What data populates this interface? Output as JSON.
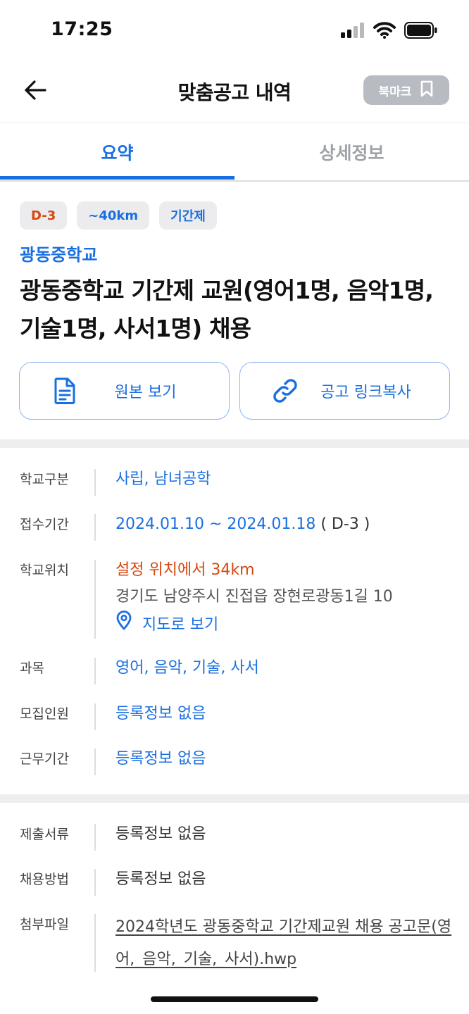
{
  "status_bar": {
    "time": "17:25"
  },
  "nav": {
    "title": "맞춤공고 내역",
    "bookmark_label": "북마크"
  },
  "tabs": [
    {
      "label": "요약",
      "active": true
    },
    {
      "label": "상세정보",
      "active": false
    }
  ],
  "badges": {
    "dday": "D-3",
    "distance": "~40km",
    "type": "기간제"
  },
  "school_name": "광동중학교",
  "posting_title": "광동중학교 기간제 교원(영어1명, 음악1명, 기술1명, 사서1명) 채용",
  "actions": {
    "view_original": "원본 보기",
    "copy_link": "공고 링크복사"
  },
  "info": {
    "school_type": {
      "label": "학교구분",
      "value": "사립, 남녀공학"
    },
    "application_period": {
      "label": "접수기간",
      "value": "2024.01.10 ~ 2024.01.18",
      "dday": "( D-3 )"
    },
    "location": {
      "label": "학교위치",
      "distance": "설정 위치에서 34km",
      "address": "경기도 남양주시 진접읍 장현로광동1길 10",
      "map_link": "지도로 보기"
    },
    "subjects": {
      "label": "과목",
      "value": "영어, 음악, 기술, 사서"
    },
    "headcount": {
      "label": "모집인원",
      "value": "등록정보 없음"
    },
    "work_period": {
      "label": "근무기간",
      "value": "등록정보 없음"
    }
  },
  "extra": {
    "documents": {
      "label": "제출서류",
      "value": "등록정보 없음"
    },
    "hiring_method": {
      "label": "채용방법",
      "value": "등록정보 없음"
    },
    "attachment": {
      "label": "첨부파일",
      "value": "2024학년도 광동중학교 기간제교원 채용 공고문(영어,_음악,_기술,_사서).hwp"
    }
  },
  "colors": {
    "accent": "#1a6fe0",
    "warning": "#d9460f",
    "bookmark_bg": "#b8bcc2"
  }
}
